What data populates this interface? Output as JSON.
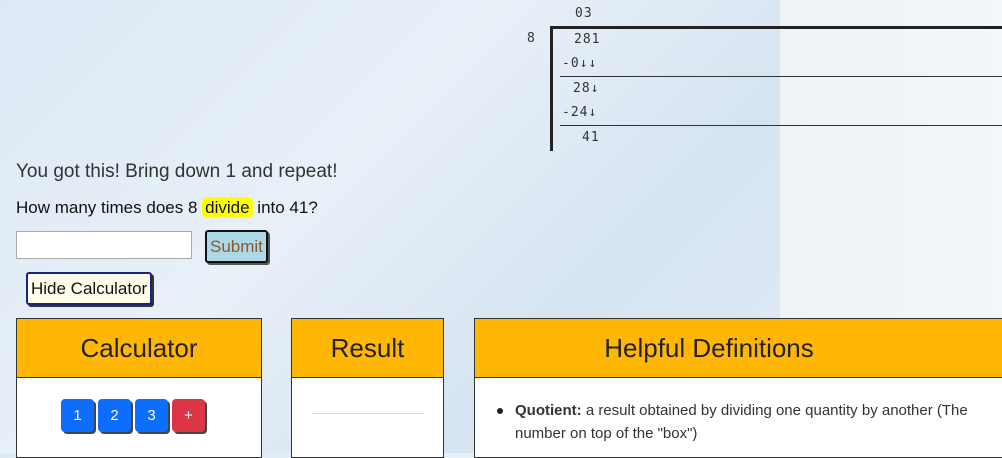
{
  "division": {
    "quotient": "03",
    "divisor": "8",
    "dividend": "281",
    "step1": "-0↓↓",
    "step2": "28↓",
    "step3": "-24↓",
    "step4": "41"
  },
  "prompt": {
    "encouragement": "You got this! Bring down 1 and repeat!",
    "question_pre": "How many times does 8",
    "question_highlight": "divide",
    "question_post": "into 41?"
  },
  "answer": {
    "value": "",
    "placeholder": ""
  },
  "buttons": {
    "submit": "Submit",
    "hide_calculator": "Hide Calculator"
  },
  "calculator": {
    "title": "Calculator",
    "keys": [
      "1",
      "2",
      "3",
      "+"
    ]
  },
  "result": {
    "title": "Result"
  },
  "definitions": {
    "title": "Helpful Definitions",
    "items": [
      {
        "term": "Quotient:",
        "text": "a result obtained by dividing one quantity by another (The number on top of the \"box\")"
      }
    ]
  },
  "colors": {
    "panel_header": "#ffb703",
    "highlight": "#ffff00",
    "submit_bg": "#add8e6",
    "key_num": "#0d6efd",
    "key_op": "#dc3545"
  }
}
